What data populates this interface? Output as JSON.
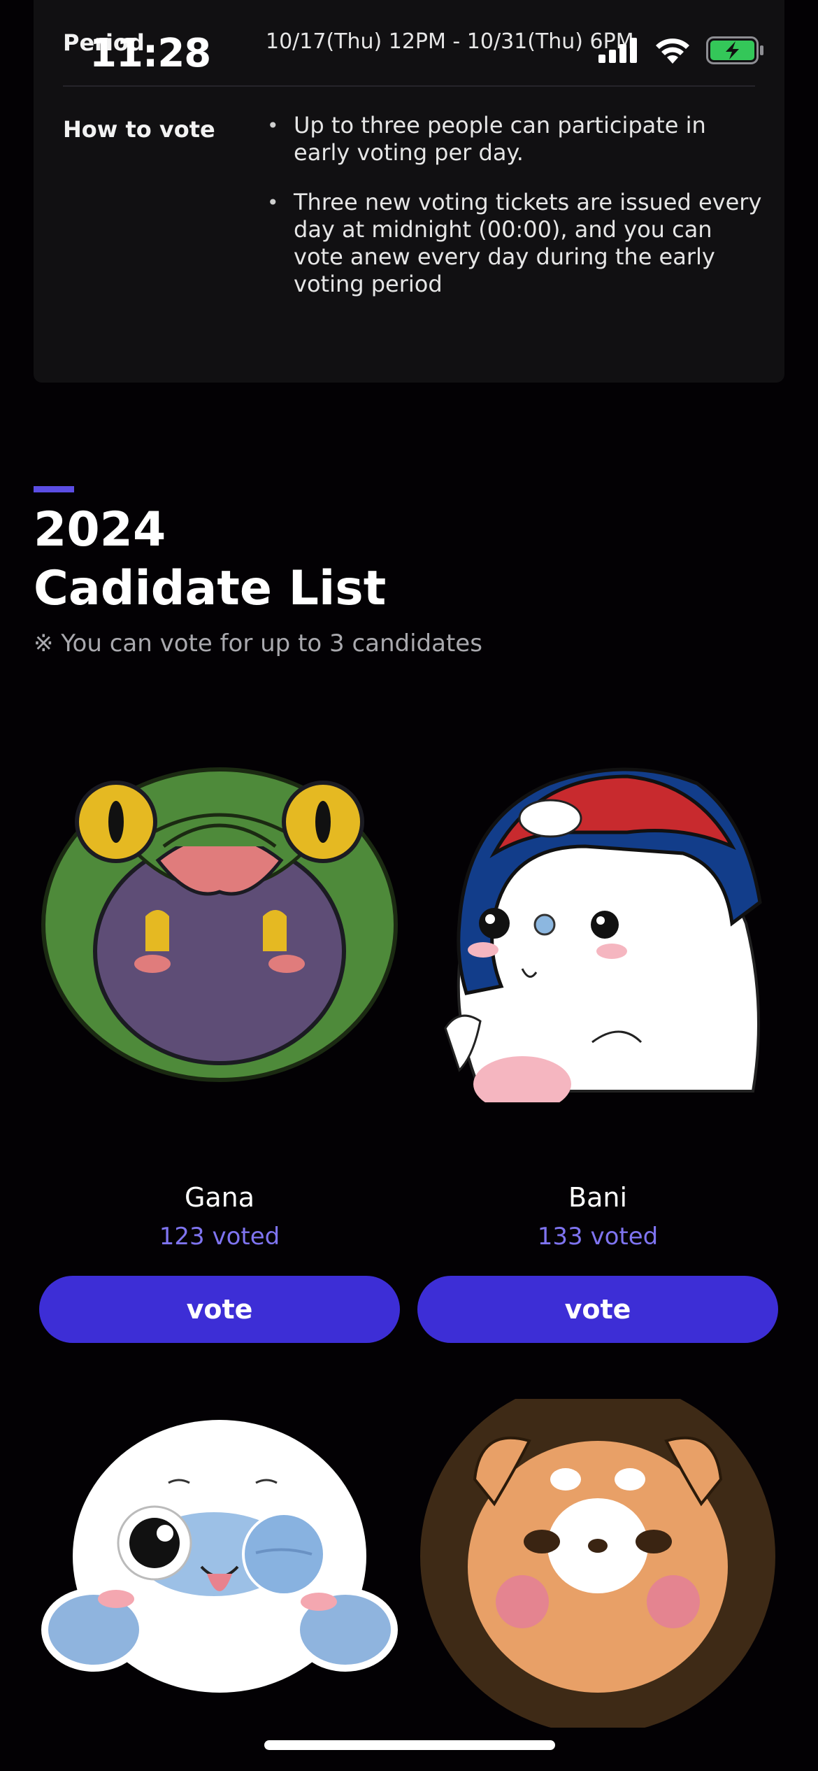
{
  "status_bar": {
    "time": "11:28",
    "icons": [
      "signal-icon",
      "wifi-icon",
      "battery-charging-icon"
    ],
    "battery_color": "#34c759"
  },
  "info": {
    "period_label": "Period",
    "period_value": "10/17(Thu) 12PM - 10/31(Thu) 6PM",
    "how_label": "How to vote",
    "how_items": [
      "Up to three people can participate in early voting per day.",
      "Three new voting tickets are issued every day at midnight (00:00), and you can vote anew every day during the early voting period"
    ]
  },
  "section": {
    "year": "2024",
    "title": "Cadidate List",
    "notice": "※ You can vote for up to 3 candidates"
  },
  "candidates": [
    {
      "name": "Gana",
      "votes": "123 voted",
      "button": "vote",
      "avatar": "green-frog-hood-character"
    },
    {
      "name": "Bani",
      "votes": "133 voted",
      "button": "vote",
      "avatar": "white-bunny-red-blue-cap-character"
    },
    {
      "name": "",
      "votes": "",
      "button": "",
      "avatar": "white-seal-winking-character"
    },
    {
      "name": "",
      "votes": "",
      "button": "",
      "avatar": "shiba-dog-character"
    }
  ],
  "colors": {
    "background": "#030104",
    "card": "#111012",
    "accent": "#5b4de4",
    "vote_button": "#3d2ed6",
    "vote_count": "#7f74f0"
  }
}
